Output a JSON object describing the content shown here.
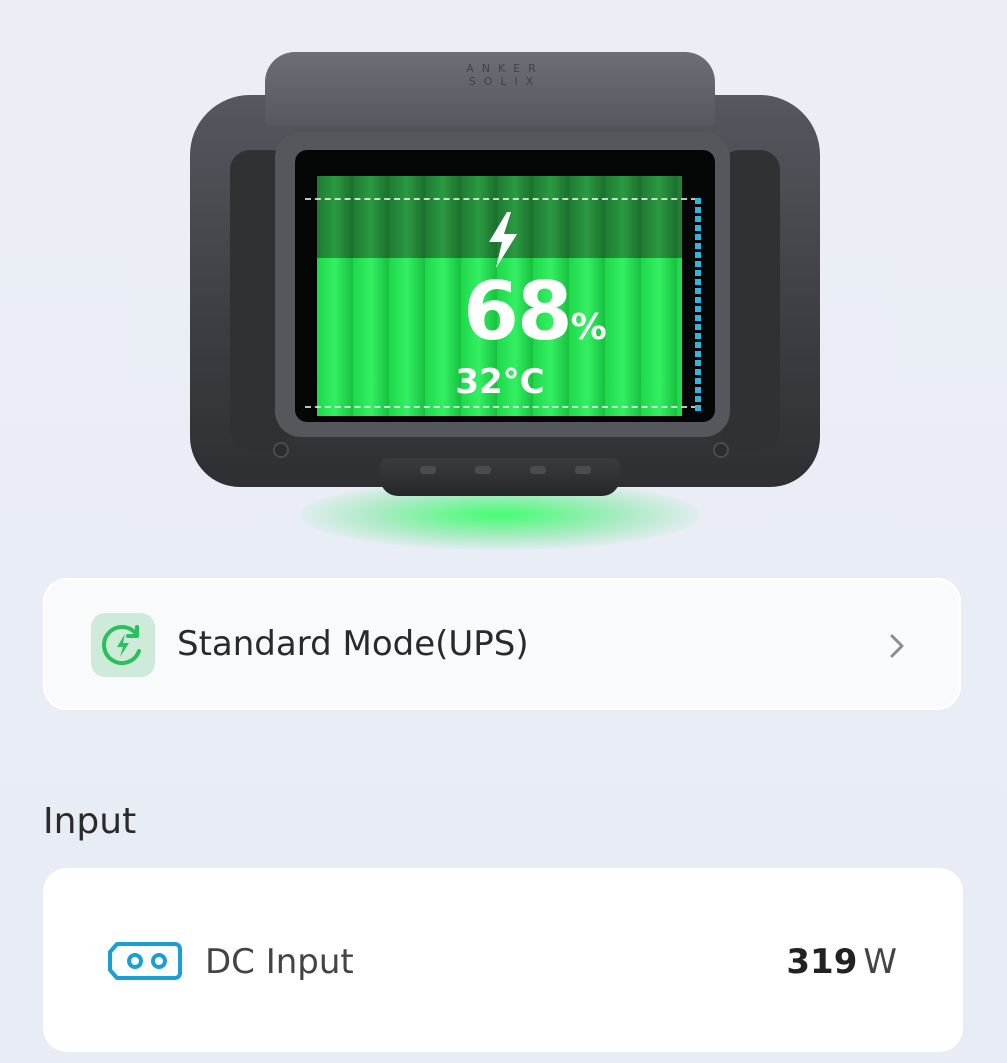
{
  "device": {
    "logo": "ANKER SOLIX",
    "battery_percent": "68",
    "battery_unit": "%",
    "temperature": "32°C",
    "battery_level": 0.68,
    "accent_color": "#2fe85e"
  },
  "mode": {
    "label": "Standard Mode(UPS)",
    "icon": "charge-mode-icon",
    "icon_color": "#2bbf5e"
  },
  "input_section": {
    "title": "Input",
    "rows": [
      {
        "label": "DC Input",
        "icon": "dc-port-icon",
        "icon_color": "#1a9ed6",
        "value": "319",
        "unit": "W"
      }
    ]
  }
}
